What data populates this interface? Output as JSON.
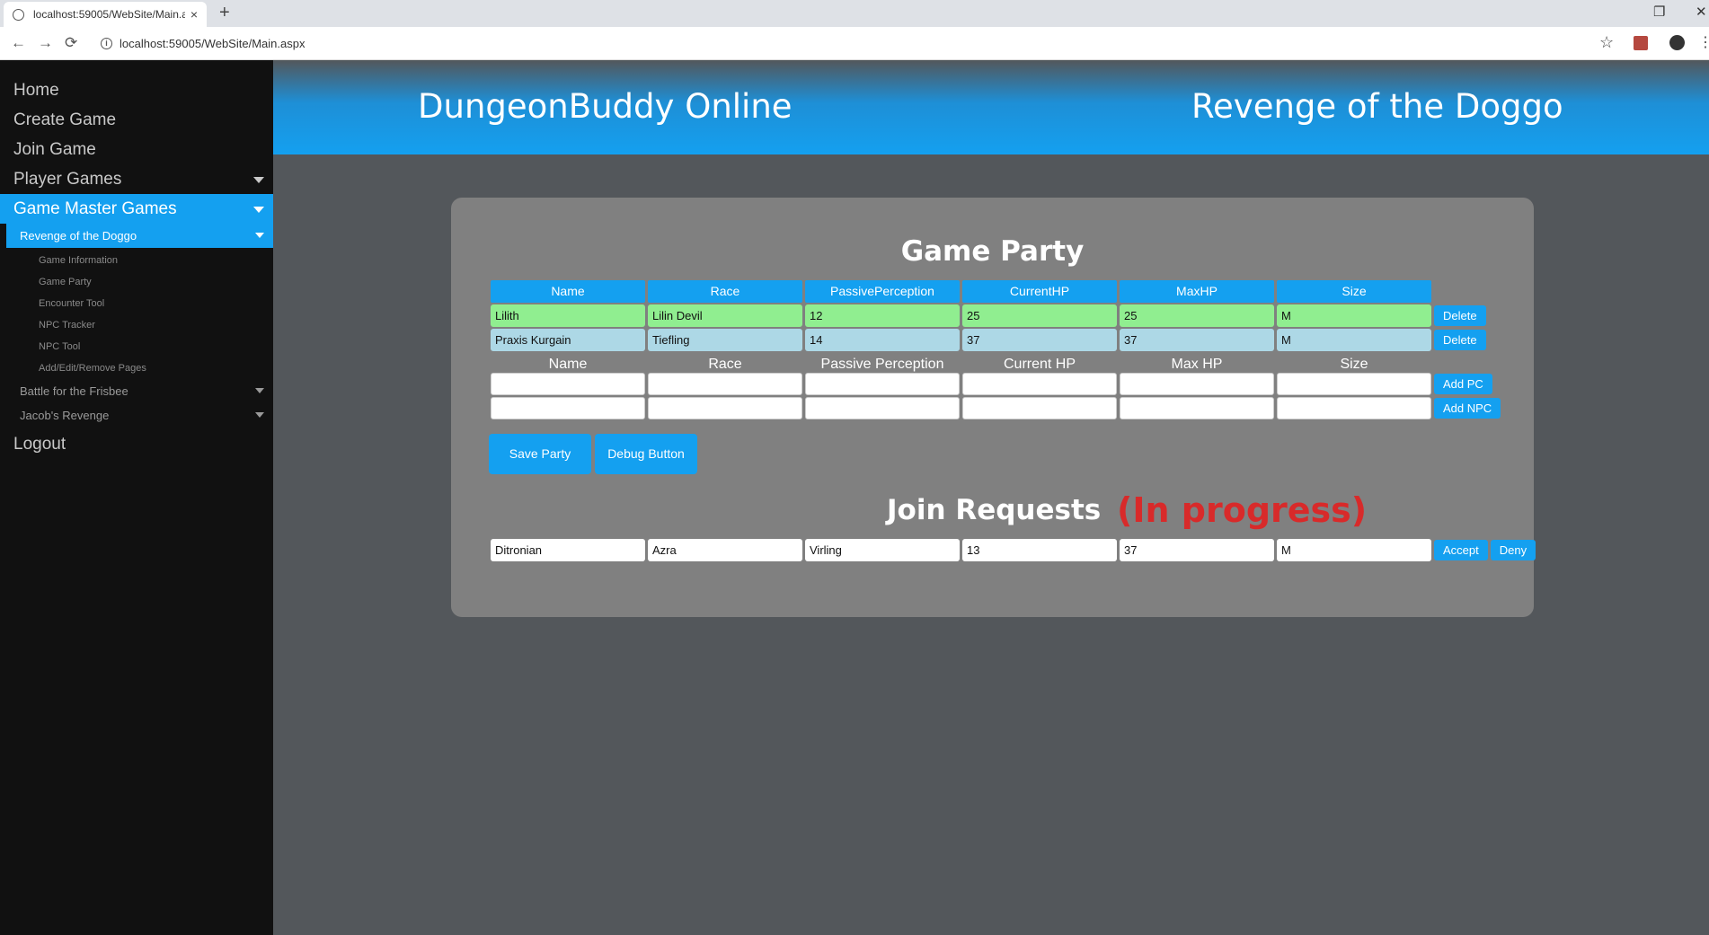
{
  "browser": {
    "tab_title": "localhost:59005/WebSite/Main.a",
    "tab_close": "×",
    "new_tab": "+",
    "url": "localhost:59005/WebSite/Main.aspx",
    "back": "←",
    "forward": "→",
    "reload": "⟳",
    "star": "☆",
    "menu": "⋮",
    "restore": "❐",
    "close": "✕"
  },
  "sidebar": {
    "items": [
      {
        "label": "Home"
      },
      {
        "label": "Create Game"
      },
      {
        "label": "Join Game"
      },
      {
        "label": "Player Games"
      },
      {
        "label": "Game Master Games"
      }
    ],
    "games": [
      {
        "label": "Revenge of the Doggo"
      },
      {
        "label": "Battle for the Frisbee"
      },
      {
        "label": "Jacob's Revenge"
      }
    ],
    "pages": [
      {
        "label": "Game Information"
      },
      {
        "label": "Game Party"
      },
      {
        "label": "Encounter Tool"
      },
      {
        "label": "NPC Tracker"
      },
      {
        "label": "NPC Tool"
      },
      {
        "label": "Add/Edit/Remove Pages"
      }
    ],
    "logout": "Logout"
  },
  "header": {
    "site_title": "DungeonBuddy Online",
    "game_title": "Revenge of the Doggo"
  },
  "party": {
    "title": "Game Party",
    "columns": [
      "Name",
      "Race",
      "PassivePerception",
      "CurrentHP",
      "MaxHP",
      "Size"
    ],
    "rows": [
      {
        "name": "Lilith",
        "race": "Lilin Devil",
        "pp": "12",
        "chp": "25",
        "mhp": "25",
        "size": "M"
      },
      {
        "name": "Praxis Kurgain",
        "race": "Tiefling",
        "pp": "14",
        "chp": "37",
        "mhp": "37",
        "size": "M"
      }
    ],
    "delete_label": "Delete",
    "input_labels": [
      "Name",
      "Race",
      "Passive Perception",
      "Current HP",
      "Max HP",
      "Size"
    ],
    "add_pc_label": "Add PC",
    "add_npc_label": "Add NPC",
    "save_label": "Save Party",
    "debug_label": "Debug Button"
  },
  "join": {
    "title": "Join Requests",
    "status": "(In progress)",
    "request": {
      "name": "Ditronian",
      "race": "Azra",
      "class": "Virling",
      "pp": "13",
      "hp": "37",
      "size": "M"
    },
    "accept_label": "Accept",
    "deny_label": "Deny"
  },
  "colors": {
    "accent": "#14a0f0",
    "pc_row": "#90ee90",
    "npc_row": "#add8e6",
    "status_red": "#d82a2a",
    "background": "#53575b",
    "panel": "#808080"
  }
}
